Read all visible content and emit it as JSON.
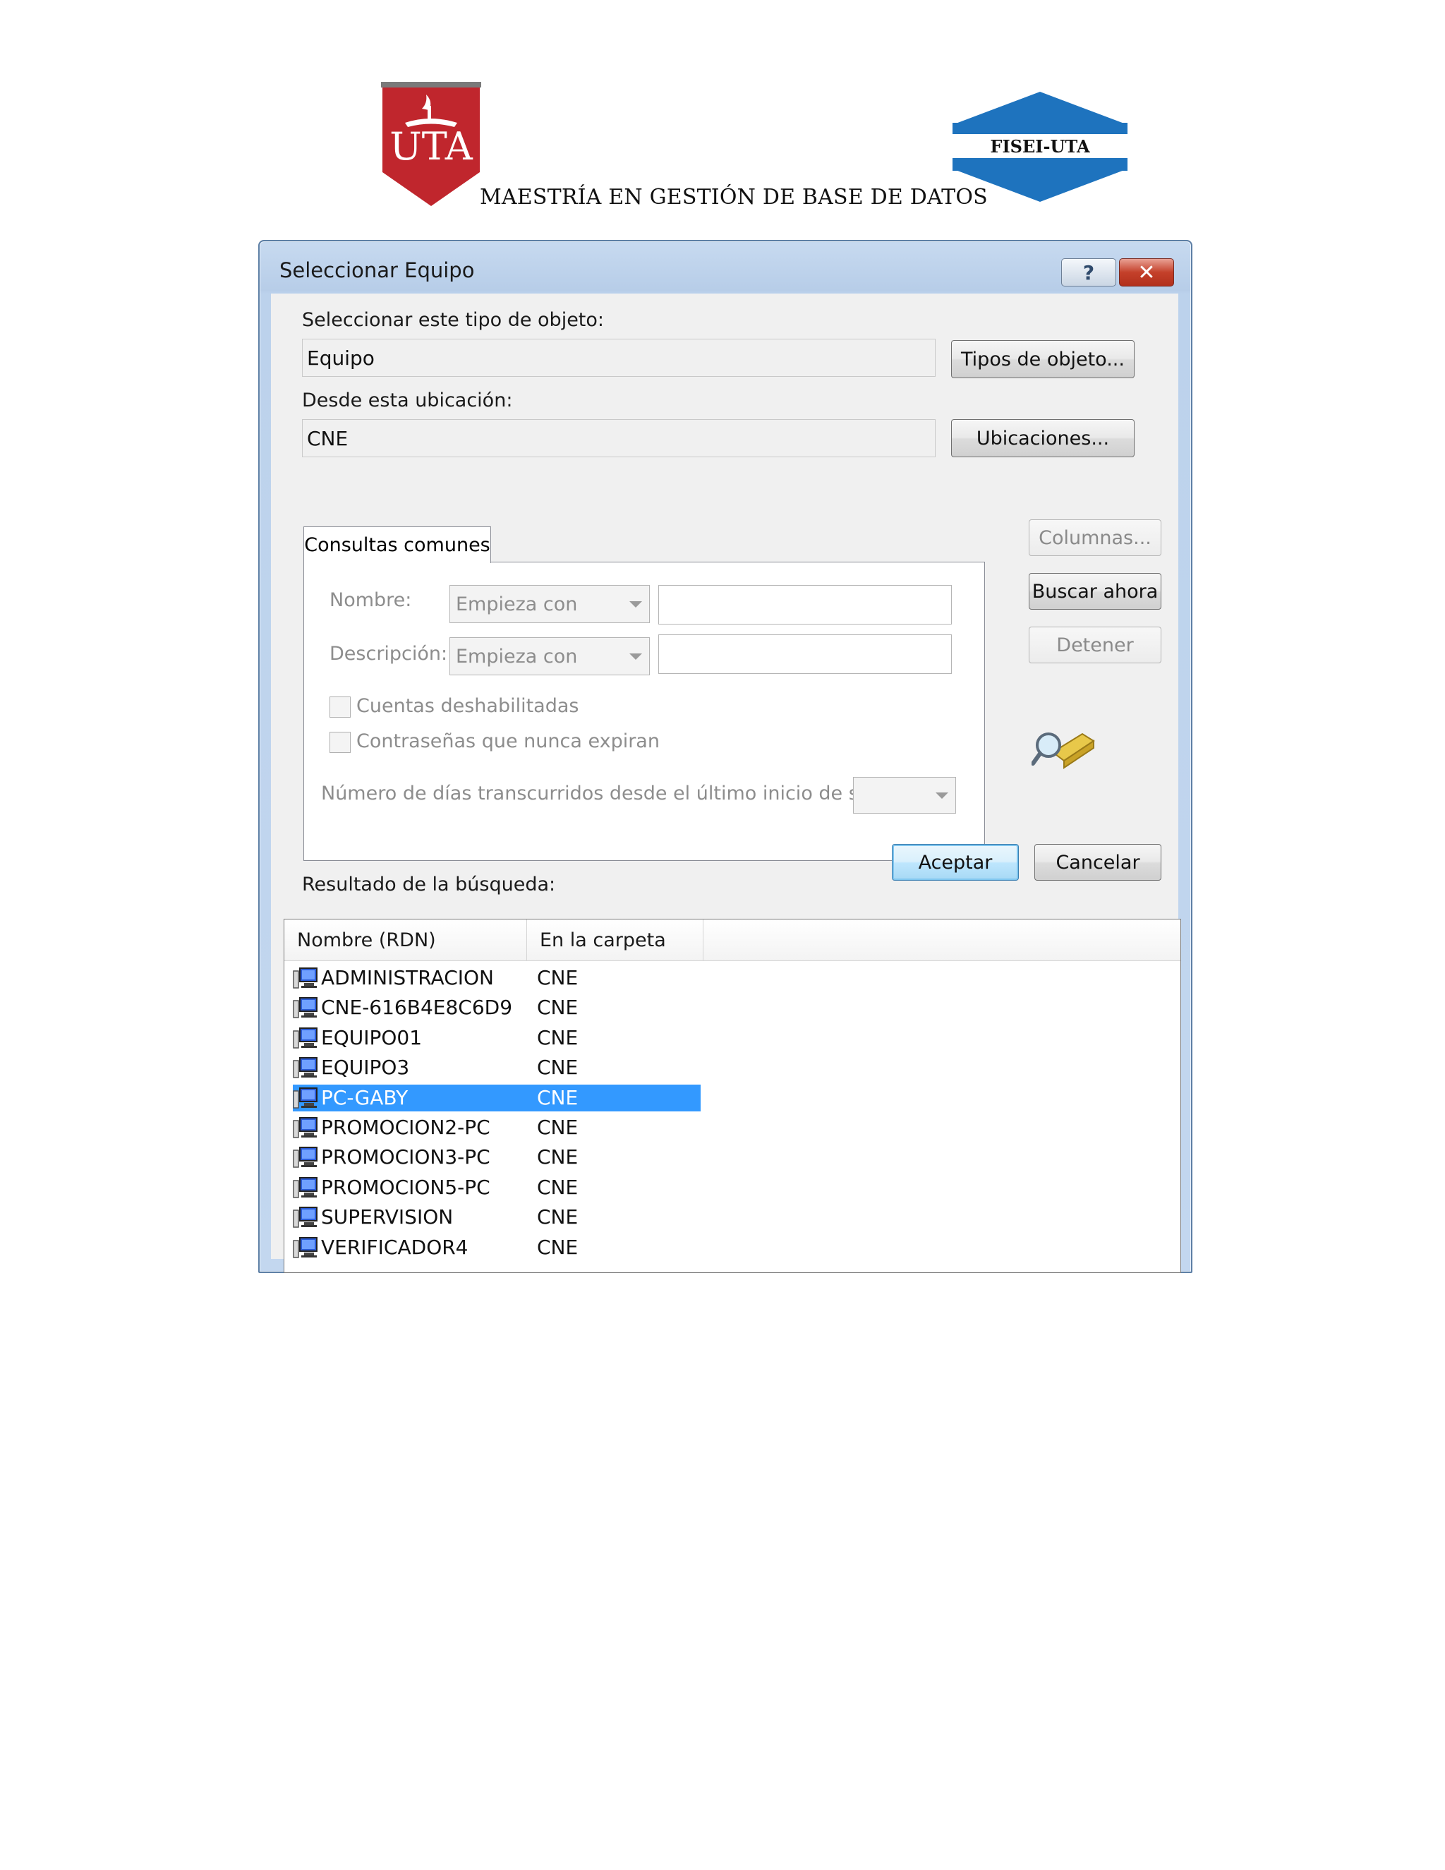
{
  "header": {
    "logo_left": "UTA",
    "logo_right": "FISEI-UTA",
    "heading": "MAESTRÍA EN GESTIÓN DE BASE DE DATOS"
  },
  "window": {
    "title": "Seleccionar Equipo",
    "help_glyph": "?",
    "close_glyph": "✕"
  },
  "object_type": {
    "label": "Seleccionar este tipo de objeto:",
    "value": "Equipo",
    "button": "Tipos de objeto..."
  },
  "location": {
    "label": "Desde esta ubicación:",
    "value": "CNE",
    "button": "Ubicaciones..."
  },
  "tab": {
    "label": "Consultas comunes",
    "name_label": "Nombre:",
    "name_mode": "Empieza con",
    "description_label": "Descripción:",
    "description_mode": "Empieza con",
    "disabled_accounts": "Cuentas deshabilitadas",
    "non_expiring": "Contraseñas que nunca expiran",
    "days_label": "Número de días transcurridos desde el último inicio de sesión:"
  },
  "side_buttons": {
    "columns": "Columnas...",
    "search_now": "Buscar ahora",
    "stop": "Detener"
  },
  "actions": {
    "ok": "Aceptar",
    "cancel": "Cancelar"
  },
  "results": {
    "label": "Resultado de la búsqueda:",
    "columns": [
      "Nombre (RDN)",
      "En la carpeta"
    ],
    "rows": [
      {
        "name": "ADMINISTRACION",
        "folder": "CNE"
      },
      {
        "name": "CNE-616B4E8C6D9",
        "folder": "CNE"
      },
      {
        "name": "EQUIPO01",
        "folder": "CNE"
      },
      {
        "name": "EQUIPO3",
        "folder": "CNE"
      },
      {
        "name": "PC-GABY",
        "folder": "CNE"
      },
      {
        "name": "PROMOCION2-PC",
        "folder": "CNE"
      },
      {
        "name": "PROMOCION3-PC",
        "folder": "CNE"
      },
      {
        "name": "PROMOCION5-PC",
        "folder": "CNE"
      },
      {
        "name": "SUPERVISION",
        "folder": "CNE"
      },
      {
        "name": "VERIFICADOR4",
        "folder": "CNE"
      }
    ],
    "selected_name": "PC-GABY"
  },
  "colors": {
    "uta_red": "#c0262d",
    "fisei_blue": "#1e73be",
    "selection": "#3399ff"
  }
}
